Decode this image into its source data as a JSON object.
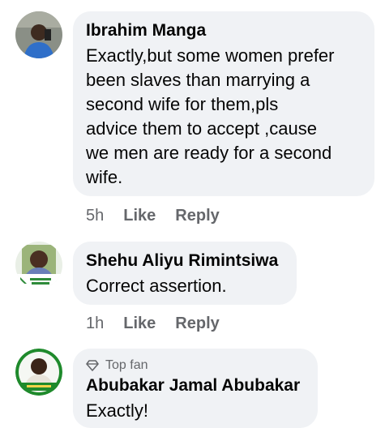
{
  "comments": [
    {
      "author": "Ibrahim Manga",
      "text_lines": [
        "Exactly,but some women prefer",
        "been slaves than marrying a",
        "second wife for them,pls",
        "advice them to accept ,cause",
        "we men are ready for a second",
        "wife."
      ],
      "time": "5h",
      "like_label": "Like",
      "reply_label": "Reply"
    },
    {
      "author": "Shehu Aliyu Rimintsiwa",
      "text_lines": [
        "Correct assertion."
      ],
      "time": "1h",
      "like_label": "Like",
      "reply_label": "Reply"
    },
    {
      "badge": "Top fan",
      "author": "Abubakar Jamal Abubakar",
      "text_lines": [
        "Exactly!"
      ]
    }
  ],
  "colors": {
    "bubble": "#f0f2f5",
    "text": "#050505",
    "secondary": "#65676b"
  }
}
